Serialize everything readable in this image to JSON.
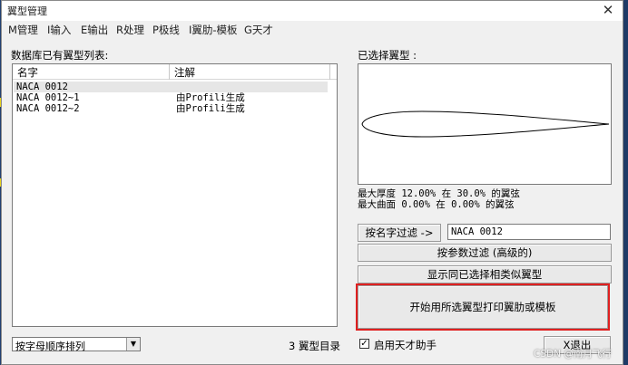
{
  "window": {
    "title": "翼型管理",
    "close_glyph": "✕"
  },
  "menu": [
    "M管理",
    "I输入",
    "E输出",
    "R处理",
    "P极线",
    "I翼肋-模板",
    "G天才"
  ],
  "list_section": {
    "label": "数据库已有翼型列表:",
    "columns": [
      "名字",
      "注解"
    ],
    "rows": [
      {
        "name": "NACA 0012",
        "note": "",
        "selected": true
      },
      {
        "name": "NACA 0012~1",
        "note": "由Profili生成",
        "selected": false
      },
      {
        "name": "NACA 0012~2",
        "note": "由Profili生成",
        "selected": false
      }
    ]
  },
  "selected_section": {
    "label": "已选择翼型 :",
    "info_line1": "最大厚度 12.00% 在 30.0% 的翼弦",
    "info_line2": "最大曲面 0.00% 在 0.00% 的翼弦"
  },
  "buttons": {
    "filter_by_name": "按名字过滤 ->",
    "filter_by_params": "按参数过滤 (高级的)",
    "show_similar": "显示同已选择相类似翼型",
    "start_print": "开始用所选翼型打印翼肋或模板",
    "exit": "X退出"
  },
  "filter_name_value": "NACA 0012",
  "sort": {
    "selected": "按字母顺序排列"
  },
  "count_text": "3 翼型目录",
  "genius_checkbox": {
    "label": "启用天才助手",
    "checked": true,
    "mark": "✓"
  },
  "watermark": "CSDN @南月飞行",
  "colors": {
    "highlight_border": "#e02020",
    "selected_row": "#e6e6e6"
  }
}
